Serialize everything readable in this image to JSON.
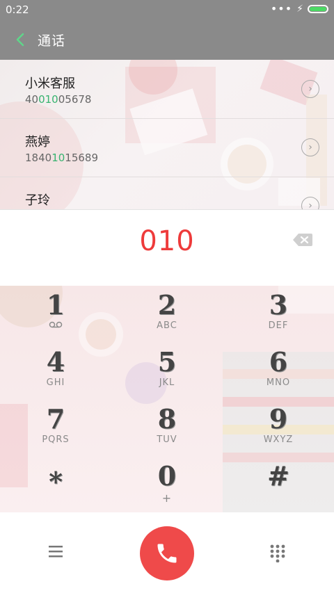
{
  "status_bar": {
    "time": "0:22",
    "signal_icon": "more-dots-icon",
    "charging_icon": "bolt-icon",
    "battery_icon": "battery-icon"
  },
  "app_bar": {
    "title": "通话",
    "back_icon": "chevron-left-icon"
  },
  "contacts": [
    {
      "name": "小米客服",
      "number_pre": "40",
      "number_match": "010",
      "number_post": "05678"
    },
    {
      "name": "燕婷",
      "number_pre": "1840",
      "number_match": "10",
      "number_post": "15689"
    },
    {
      "name": "子玲",
      "number_pre": "",
      "number_match": "",
      "number_post": ""
    }
  ],
  "dial": {
    "number": "010",
    "backspace_icon": "backspace-icon"
  },
  "keypad": [
    {
      "digit": "1",
      "letters": ""
    },
    {
      "digit": "2",
      "letters": "ABC"
    },
    {
      "digit": "3",
      "letters": "DEF"
    },
    {
      "digit": "4",
      "letters": "GHI"
    },
    {
      "digit": "5",
      "letters": "JKL"
    },
    {
      "digit": "6",
      "letters": "MNO"
    },
    {
      "digit": "7",
      "letters": "PQRS"
    },
    {
      "digit": "8",
      "letters": "TUV"
    },
    {
      "digit": "9",
      "letters": "WXYZ"
    },
    {
      "digit": "*",
      "letters": ""
    },
    {
      "digit": "0",
      "letters": "+"
    },
    {
      "digit": "#",
      "letters": ""
    }
  ],
  "bottom_bar": {
    "menu_icon": "menu-icon",
    "call_icon": "phone-icon",
    "dialpad_icon": "dialpad-icon"
  },
  "colors": {
    "accent_red": "#ee3b3b",
    "call_button": "#ef4a4a",
    "match_green": "#37b36f",
    "bar_gray": "#8a8a8a"
  }
}
